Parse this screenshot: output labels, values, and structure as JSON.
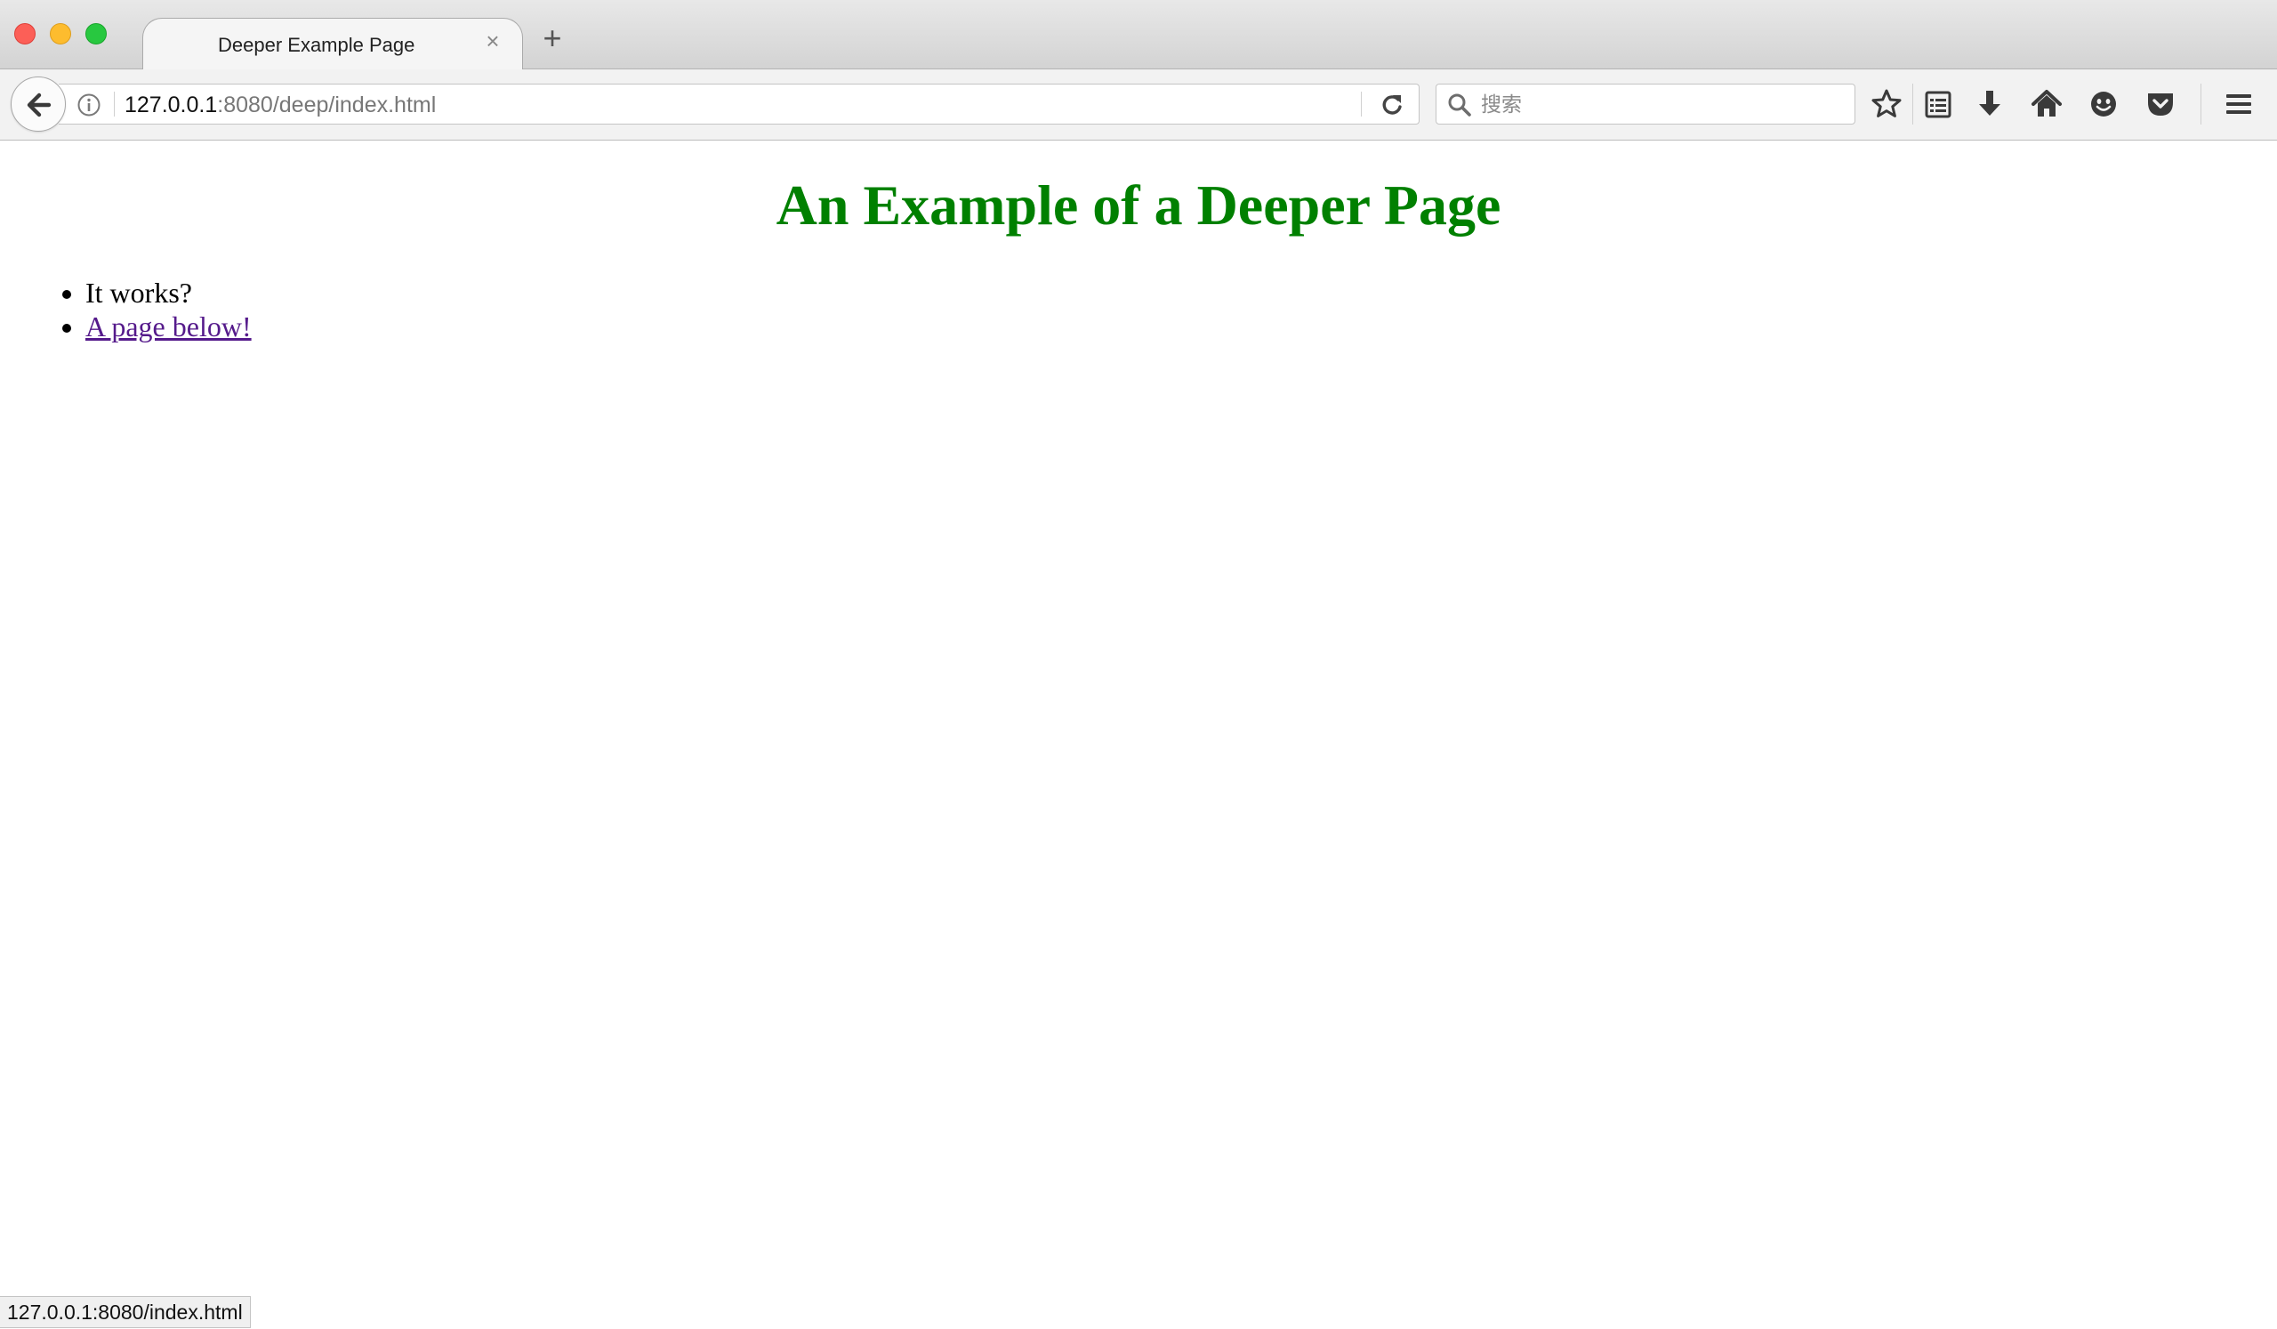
{
  "window": {
    "tab_title": "Deeper Example Page",
    "tab_close_glyph": "×",
    "new_tab_glyph": "+"
  },
  "toolbar": {
    "url_host": "127.0.0.1",
    "url_rest": ":8080/deep/index.html",
    "search_placeholder": "搜索",
    "icons": [
      "back-arrow-icon",
      "info-icon",
      "reload-icon",
      "search-icon",
      "bookmark-star-icon",
      "reading-list-icon",
      "download-icon",
      "home-icon",
      "smiley-icon",
      "pocket-icon",
      "hamburger-menu-icon"
    ]
  },
  "page": {
    "heading": "An Example of a Deeper Page",
    "items": [
      {
        "text": "It works?"
      },
      {
        "text": "A page below!"
      }
    ],
    "heading_color": "#008000",
    "link_color": "#551a8b"
  },
  "status": {
    "url": "127.0.0.1:8080/index.html"
  }
}
